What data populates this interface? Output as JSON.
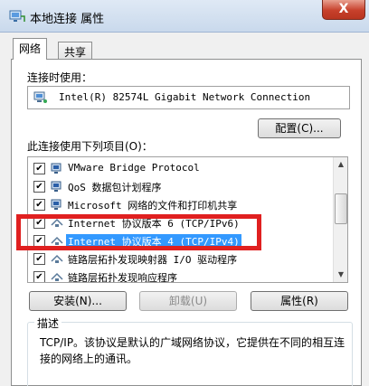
{
  "window": {
    "title": "本地连接 属性",
    "close_label": "X"
  },
  "tabs": [
    {
      "label": "网络",
      "active": true
    },
    {
      "label": "共享",
      "active": false
    }
  ],
  "connect_using": {
    "label": "连接时使用：",
    "adapter": "Intel(R) 82574L Gigabit Network Connection",
    "configure_label": "配置(C)..."
  },
  "items_section": {
    "label": "此连接使用下列项目(O)：",
    "items": [
      {
        "label": "VMware Bridge Protocol",
        "checked": true,
        "icon": "network-protocol-icon"
      },
      {
        "label": "QoS 数据包计划程序",
        "checked": true,
        "icon": "qos-scheduler-icon"
      },
      {
        "label": "Microsoft 网络的文件和打印机共享",
        "checked": true,
        "icon": "file-printer-sharing-icon"
      },
      {
        "label": "Internet 协议版本 6 (TCP/IPv6)",
        "checked": true,
        "icon": "protocol-icon"
      },
      {
        "label": "Internet 协议版本 4 (TCP/IPv4)",
        "checked": true,
        "icon": "protocol-icon",
        "selected": true
      },
      {
        "label": "链路层拓扑发现映射器 I/O 驱动程序",
        "checked": true,
        "icon": "protocol-icon"
      },
      {
        "label": "链路层拓扑发现响应程序",
        "checked": true,
        "icon": "protocol-icon"
      }
    ]
  },
  "buttons": {
    "install": "安装(N)...",
    "uninstall": "卸载(U)",
    "properties": "属性(R)"
  },
  "description": {
    "legend": "描述",
    "text": "TCP/IP。该协议是默认的广域网络协议，它提供在不同的相互连接的网络上的通讯。"
  },
  "colors": {
    "selection": "#3399ff",
    "highlight_frame": "#e02020",
    "close_button": "#c7402b"
  }
}
